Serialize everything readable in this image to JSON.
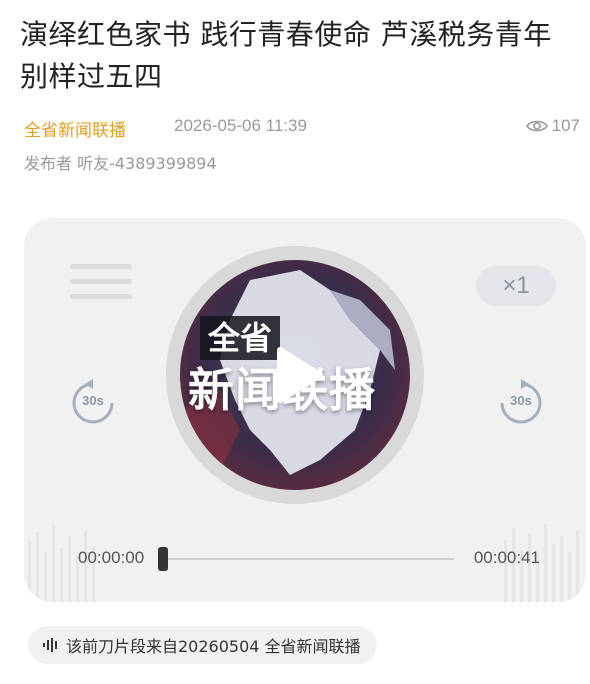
{
  "article": {
    "title": "演绎红色家书 践行青春使命 芦溪税务青年别样过五四",
    "source": "全省新闻联播",
    "date": "2026-05-06 11:39",
    "views": "107",
    "publisher": "发布者 听友-4389399894"
  },
  "player": {
    "speed": "×1",
    "skip_back_label": "30s",
    "skip_forward_label": "30s",
    "cover_line1": "全省",
    "cover_line2": "新闻联播",
    "current_time": "00:00:00",
    "total_time": "00:00:41",
    "progress": 0.0
  },
  "clip_note": "该前刀片段来自20260504 全省新闻联播",
  "colors": {
    "source": "#e0a020",
    "meta": "#999999",
    "player_bg": "#f1f1f2",
    "speed_text": "#8a93a1"
  }
}
